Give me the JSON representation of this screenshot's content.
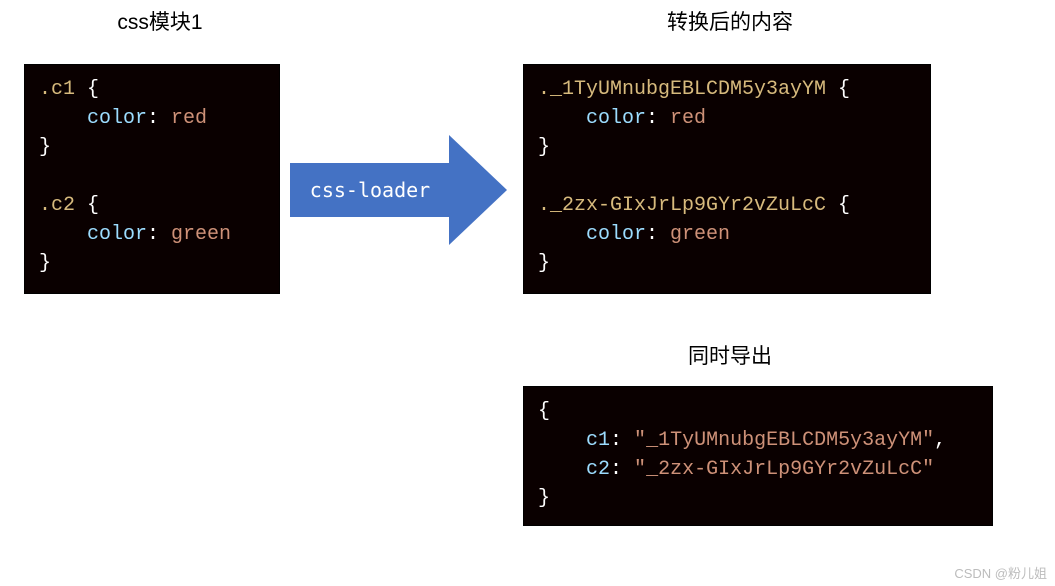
{
  "titles": {
    "left": "css模块1",
    "right_top": "转换后的内容",
    "right_bottom": "同时导出"
  },
  "arrow_label": "css-loader",
  "source_css": {
    "rules": [
      {
        "selector": ".c1",
        "prop": "color",
        "value": "red"
      },
      {
        "selector": ".c2",
        "prop": "color",
        "value": "green"
      }
    ]
  },
  "transformed_css": {
    "rules": [
      {
        "selector": "._1TyUMnubgEBLCDM5y3ayYM",
        "prop": "color",
        "value": "red"
      },
      {
        "selector": "._2zx-GIxJrLp9GYr2vZuLcC",
        "prop": "color",
        "value": "green"
      }
    ]
  },
  "export_mapping": {
    "entries": [
      {
        "key": "c1",
        "value": "_1TyUMnubgEBLCDM5y3ayYM"
      },
      {
        "key": "c2",
        "value": "_2zx-GIxJrLp9GYr2vZuLcC"
      }
    ]
  },
  "watermark": "CSDN @粉儿姐",
  "colors": {
    "arrow": "#4472c4",
    "code_bg": "#0a0000",
    "selector": "#d7ba7d",
    "property": "#9cdcfe",
    "value": "#ce9178",
    "punct": "#ffffff"
  }
}
